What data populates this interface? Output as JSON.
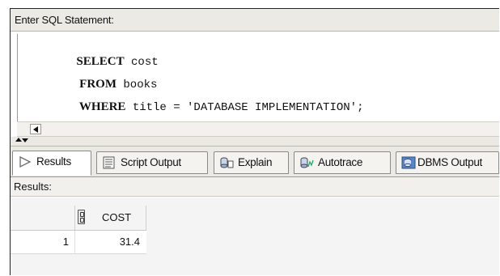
{
  "editor": {
    "label": "Enter SQL Statement:",
    "lines": [
      {
        "keyword": "SELECT",
        "rest": " cost"
      },
      {
        "keyword": " FROM",
        "rest": " books"
      },
      {
        "keyword": " WHERE",
        "rest": " title = 'DATABASE IMPLEMENTATION';"
      }
    ]
  },
  "tabs": [
    {
      "label": "Results",
      "icon": "play-arrow-icon",
      "active": true
    },
    {
      "label": "Script Output",
      "icon": "script-icon",
      "active": false
    },
    {
      "label": "Explain",
      "icon": "explain-plan-icon",
      "active": false
    },
    {
      "label": "Autotrace",
      "icon": "autotrace-icon",
      "active": false
    },
    {
      "label": "DBMS Output",
      "icon": "dbms-output-icon",
      "active": false
    }
  ],
  "results": {
    "label": "Results:",
    "columns": [
      "COST"
    ],
    "rows": [
      {
        "num": "1",
        "cells": [
          "31.4"
        ]
      }
    ]
  }
}
